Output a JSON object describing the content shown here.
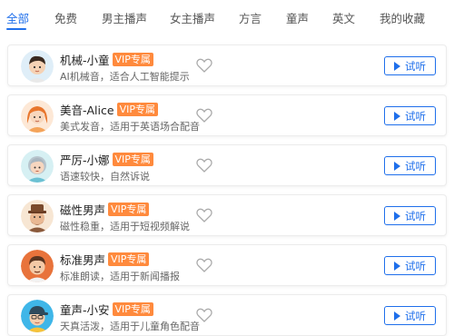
{
  "tabs": [
    {
      "label": "全部",
      "active": true
    },
    {
      "label": "免费",
      "active": false
    },
    {
      "label": "男主播声",
      "active": false
    },
    {
      "label": "女主播声",
      "active": false
    },
    {
      "label": "方言",
      "active": false
    },
    {
      "label": "童声",
      "active": false
    },
    {
      "label": "英文",
      "active": false
    },
    {
      "label": "我的收藏",
      "active": false
    }
  ],
  "voices": [
    {
      "name": "机械-小童",
      "badge": "VIP专属",
      "desc": "AI机械音，适合人工智能提示",
      "listen_label": "试听",
      "avatar_icon": "robot-boy-avatar",
      "favorited": false
    },
    {
      "name": "美音-Alice",
      "badge": "VIP专属",
      "desc": "美式发音，适用于英语场合配音",
      "listen_label": "试听",
      "avatar_icon": "orange-hair-girl-avatar",
      "favorited": false
    },
    {
      "name": "严厉-小娜",
      "badge": "VIP专属",
      "desc": "语速较快，自然诉说",
      "listen_label": "试听",
      "avatar_icon": "grey-hair-woman-avatar",
      "favorited": false
    },
    {
      "name": "磁性男声",
      "badge": "VIP专属",
      "desc": "磁性稳重，适用于短视频解说",
      "listen_label": "试听",
      "avatar_icon": "hat-man-avatar",
      "favorited": false
    },
    {
      "name": "标准男声",
      "badge": "VIP专属",
      "desc": "标准朗读，适用于新闻播报",
      "listen_label": "试听",
      "avatar_icon": "brown-hair-man-avatar",
      "favorited": false
    },
    {
      "name": "童声-小安",
      "badge": "VIP专属",
      "desc": "天真活泼，适用于儿童角色配音",
      "listen_label": "试听",
      "avatar_icon": "cap-boy-avatar",
      "favorited": false
    }
  ],
  "colors": {
    "accent": "#1f6feb",
    "vip": "#ff8a3d"
  }
}
